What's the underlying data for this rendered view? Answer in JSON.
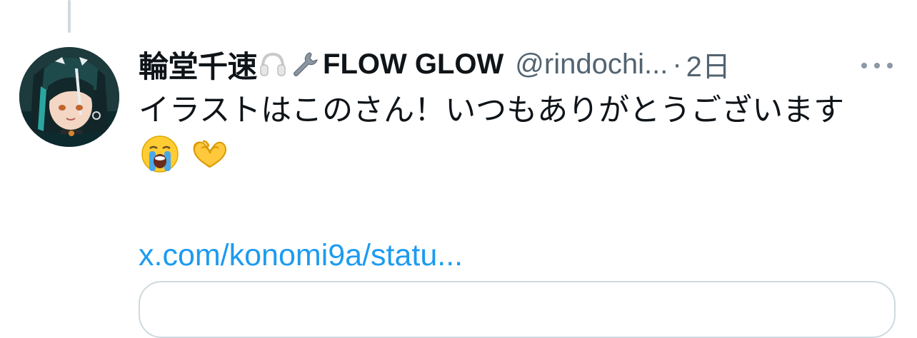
{
  "tweet": {
    "author_name": "輪堂千速",
    "author_name_suffix": "FLOW GLOW",
    "handle": "@rindochi...",
    "separator": "·",
    "time": "2日",
    "text": "イラストはこのさん！いつもありがとうございます",
    "emojis": [
      "loudly-crying-face",
      "heart-hands"
    ],
    "link": "x.com/konomi9a/statu..."
  },
  "colors": {
    "link": "#1d9bf0",
    "secondary_text": "#536471",
    "primary_text": "#0f1419",
    "border": "#cfd9de"
  },
  "icons": {
    "name_badges": [
      "headphones-icon",
      "wrench-icon"
    ],
    "menu": "more-options-icon"
  }
}
